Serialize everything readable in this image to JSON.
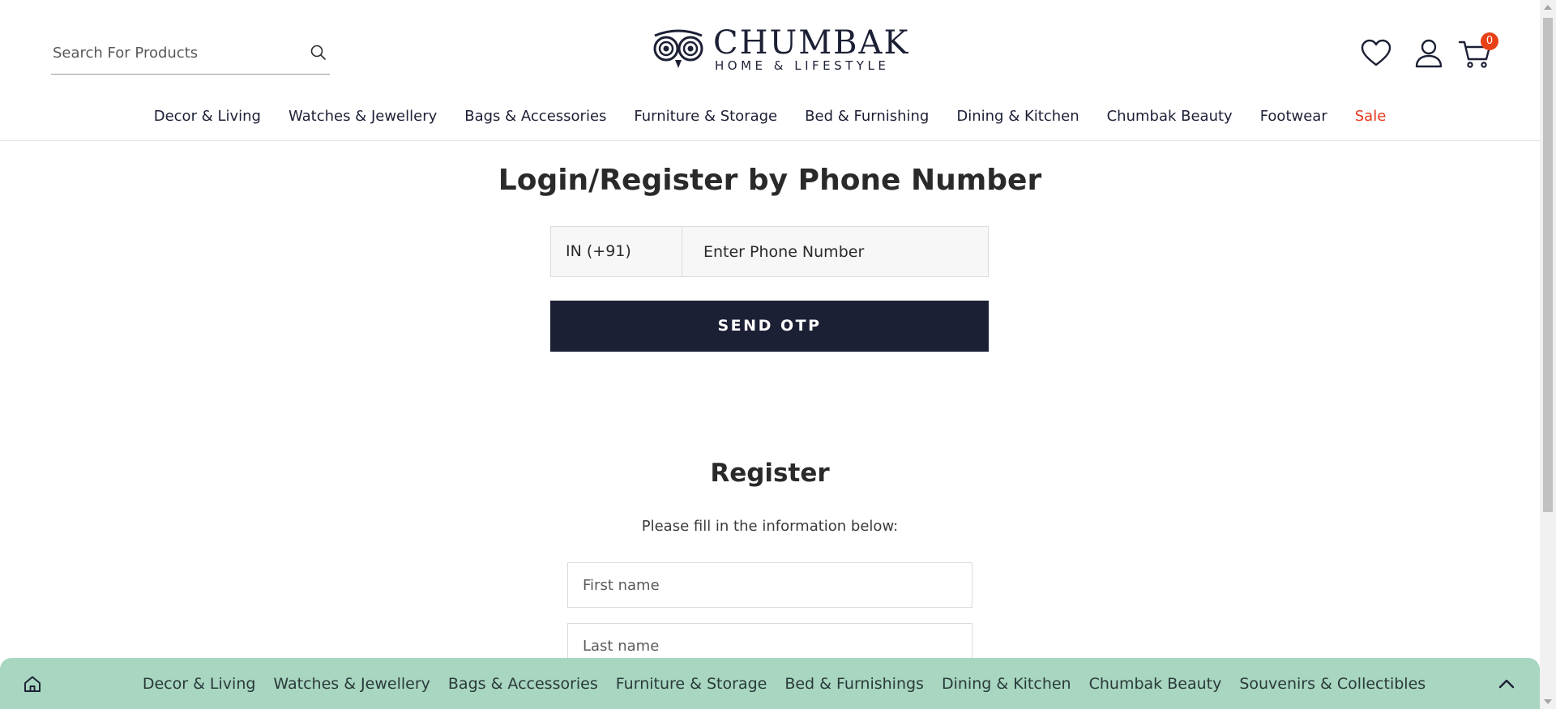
{
  "header": {
    "search": {
      "placeholder": "Search For Products",
      "value": ""
    },
    "logo": {
      "name": "CHUMBAK",
      "tagline": "HOME & LIFESTYLE"
    },
    "cart_count": "0",
    "icons": [
      "search-icon",
      "wishlist-heart-icon",
      "account-user-icon",
      "cart-icon"
    ]
  },
  "nav": {
    "items": [
      {
        "label": "Decor & Living"
      },
      {
        "label": "Watches & Jewellery"
      },
      {
        "label": "Bags & Accessories"
      },
      {
        "label": "Furniture & Storage"
      },
      {
        "label": "Bed & Furnishing"
      },
      {
        "label": "Dining & Kitchen"
      },
      {
        "label": "Chumbak Beauty"
      },
      {
        "label": "Footwear"
      },
      {
        "label": "Sale"
      }
    ]
  },
  "login": {
    "title": "Login/Register by Phone Number",
    "country_code": "IN (+91)",
    "phone_placeholder": "Enter Phone Number",
    "phone_value": "",
    "send_otp_label": "SEND OTP"
  },
  "register": {
    "title": "Register",
    "subtitle": "Please fill in the information below:",
    "first_name_placeholder": "First name",
    "last_name_placeholder": "Last name"
  },
  "bottom_bar": {
    "items": [
      {
        "label": "Decor & Living"
      },
      {
        "label": "Watches & Jewellery"
      },
      {
        "label": "Bags & Accessories"
      },
      {
        "label": "Furniture & Storage"
      },
      {
        "label": "Bed & Furnishings"
      },
      {
        "label": "Dining & Kitchen"
      },
      {
        "label": "Chumbak Beauty"
      },
      {
        "label": "Souvenirs & Collectibles"
      }
    ],
    "icons": [
      "home-icon",
      "chevron-up-icon"
    ]
  },
  "colors": {
    "brand_navy": "#1c2035",
    "sale_red": "#e8381b",
    "badge_red": "#e84118",
    "bottom_bar_green": "#a8d6c0"
  }
}
